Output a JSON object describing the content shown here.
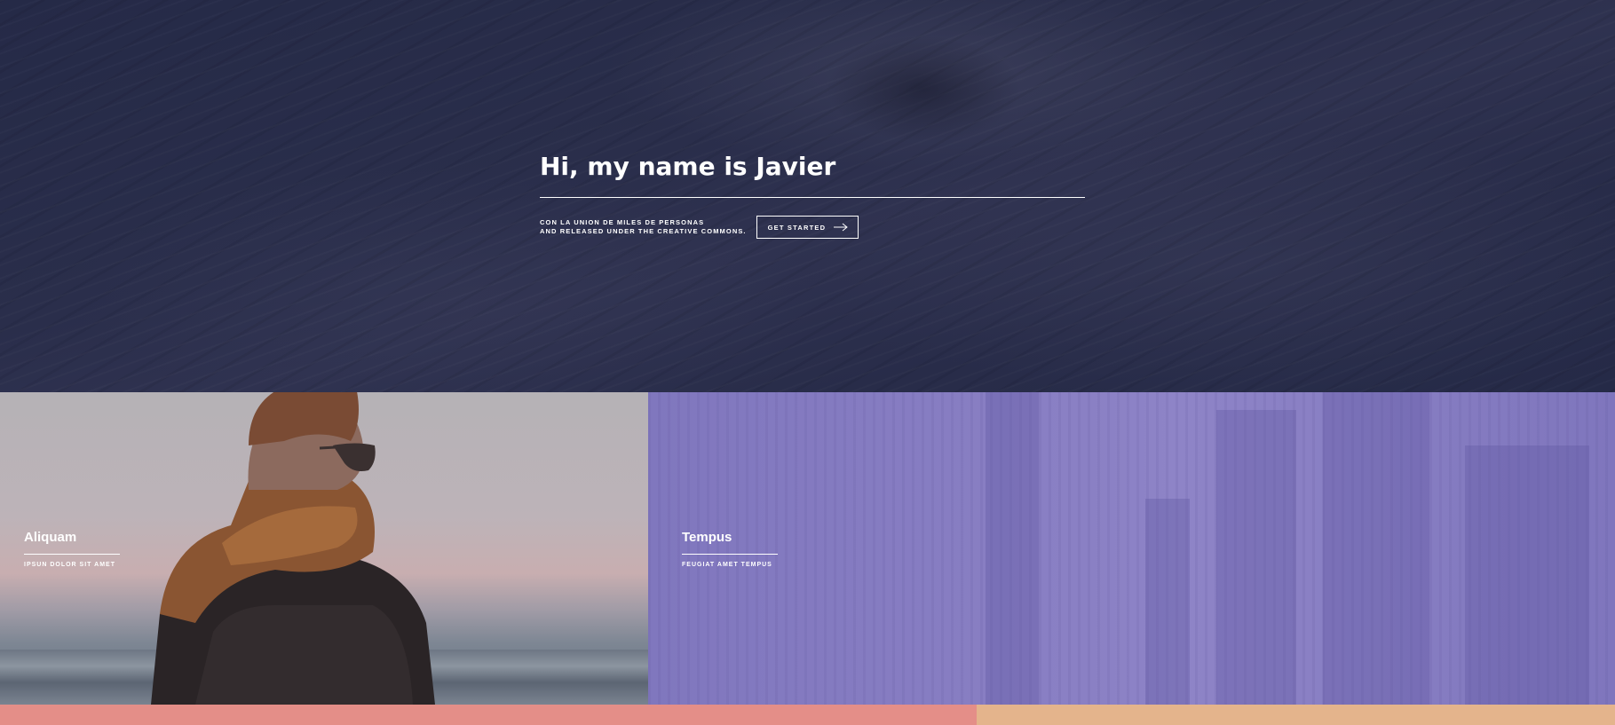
{
  "hero": {
    "title": "Hi, my name is Javier",
    "subtitle_line1": "CON LA UNION DE MILES DE PERSONAS",
    "subtitle_line2": "AND RELEASED UNDER THE CREATIVE COMMONS.",
    "button_label": "GET STARTED",
    "button_icon": "arrow-right-icon"
  },
  "tiles": [
    {
      "title": "Aliquam",
      "subtitle": "IPSUN DOLOR SIT AMET",
      "color": "#b9b2b6"
    },
    {
      "title": "Tempus",
      "subtitle": "FEUGIAT AMET TEMPUS",
      "color": "#8a80c4"
    }
  ],
  "strips": [
    {
      "color": "#e48e88"
    },
    {
      "color": "#e4b48c"
    }
  ],
  "colors": {
    "background": "#242943",
    "text": "#ffffff"
  }
}
